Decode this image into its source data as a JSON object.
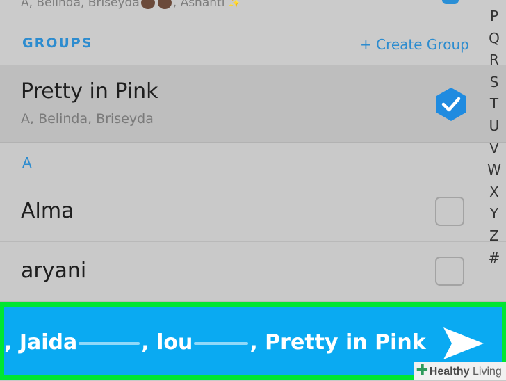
{
  "top_row": {
    "members_preview": "A, Belinda, Briseyda",
    "trailing": ", Ashanti"
  },
  "groups_section": {
    "title": "GROUPS",
    "create_label": "+ Create Group"
  },
  "group": {
    "name": "Pretty in Pink",
    "members": "A, Belinda, Briseyda",
    "selected": true
  },
  "letter_section": {
    "letter": "A"
  },
  "friends": [
    {
      "name": "Alma",
      "selected": false
    },
    {
      "name": "aryani",
      "selected": false
    }
  ],
  "alphabet_index": [
    "P",
    "Q",
    "R",
    "S",
    "T",
    "U",
    "V",
    "W",
    "X",
    "Y",
    "Z",
    "#"
  ],
  "send_bar": {
    "part1": ", Jaida",
    "part2": ", lou",
    "part3": ", Pretty in Pink"
  },
  "watermark": {
    "brand": "Healthy",
    "suffix": " Living"
  },
  "colors": {
    "accent": "#2d8ccf",
    "send_bar": "#0aaaf2",
    "highlight_border": "#00e633"
  }
}
